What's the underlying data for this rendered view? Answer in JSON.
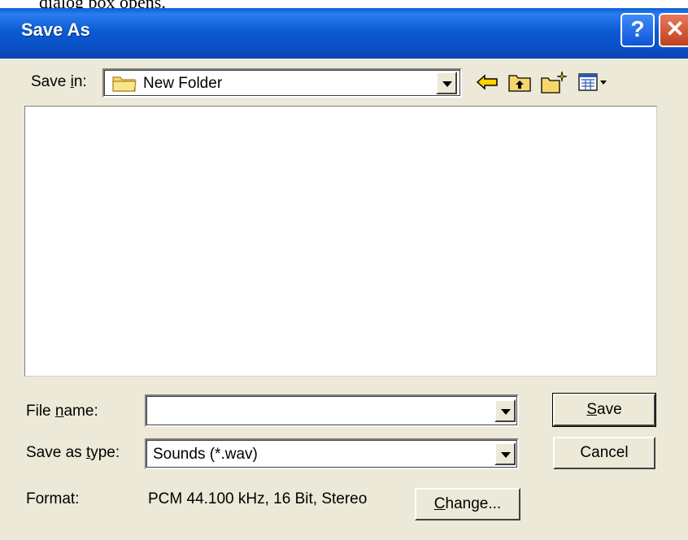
{
  "caption_fragment": "dialog box opens.",
  "window": {
    "title": "Save As",
    "help_label": "?",
    "close_label": "✕"
  },
  "save_in": {
    "label_pre": "Save ",
    "label_mnemonic": "i",
    "label_post": "n:",
    "value": "New Folder"
  },
  "toolbar": {
    "icons": [
      "back-arrow-icon",
      "up-one-level-icon",
      "new-folder-icon",
      "view-menu-icon"
    ]
  },
  "file_name": {
    "label_pre": "File ",
    "label_mnemonic": "n",
    "label_post": "ame:",
    "value": ""
  },
  "save_as_type": {
    "label_pre": "Save as ",
    "label_mnemonic": "t",
    "label_post": "ype:",
    "value": "Sounds (*.wav)"
  },
  "format": {
    "label": "Format:",
    "value": "PCM 44.100 kHz, 16 Bit, Stereo"
  },
  "buttons": {
    "save_mnemonic": "S",
    "save_rest": "ave",
    "cancel": "Cancel",
    "change_mnemonic": "C",
    "change_rest": "hange..."
  },
  "colors": {
    "titlebar": "#0a5fd6",
    "dialog_bg": "#ece9d8",
    "close_button": "#c0401e"
  }
}
